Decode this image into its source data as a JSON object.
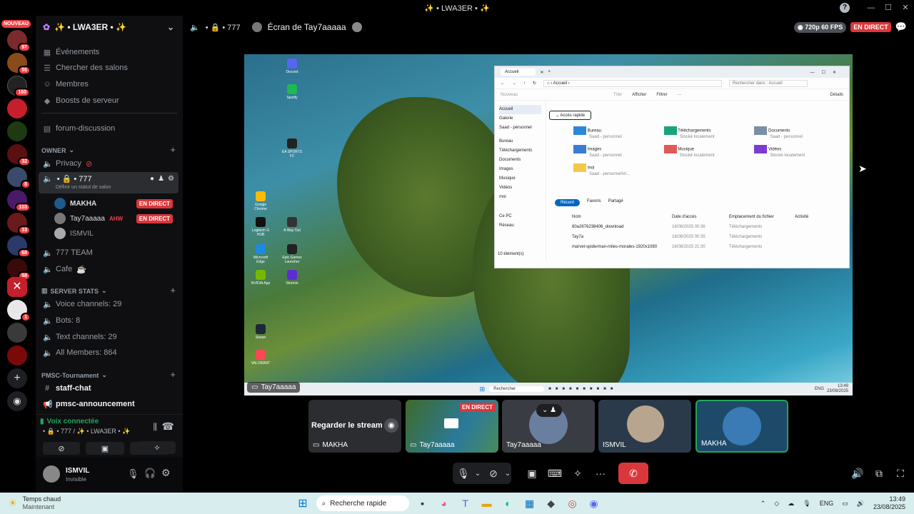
{
  "window": {
    "title": "✨ • LWA3ER • ✨"
  },
  "guilds": {
    "new_badge": "NOUVEAU",
    "badges": [
      "97",
      "56",
      "160",
      "32",
      "8",
      "103",
      "33",
      "68",
      "58",
      "1"
    ]
  },
  "server": {
    "name": "✨ • LWA3ER • ✨",
    "menu": [
      "Événements",
      "Chercher des salons",
      "Membres",
      "Boosts de serveur"
    ],
    "forum": "forum-discussion",
    "category_owner": "OWNER",
    "privacy": "Privacy",
    "voice_channel": "• 🔒 • 777",
    "voice_status": "Définir un statut de salon",
    "voice_users": [
      {
        "name": "MAKHA",
        "live": "EN DIRECT"
      },
      {
        "name": "Tay7aaaaa",
        "tag": "AHW",
        "live": "EN DIRECT"
      },
      {
        "name": "ISMVIL"
      }
    ],
    "team": "777 TEAM",
    "cafe": "Cafe",
    "category_stats": "SERVER STATS",
    "stats": [
      "Voice channels: 29",
      "Bots: 8",
      "Text channels: 29",
      "All Members: 864"
    ],
    "category_pmsc": "PMSC-Tournament",
    "pmsc_channels": [
      "staff-chat",
      "pmsc-announcement"
    ]
  },
  "voice": {
    "status": "Voix connectée",
    "location": "• 🔒 • 777 / ✨ • LWA3ER • ✨"
  },
  "user": {
    "name": "ISMVIL",
    "status": "Invisible"
  },
  "stage": {
    "channel": "• 🔒 • 777",
    "screen": "Écran de Tay7aaaaa",
    "quality": "720p 60 FPS",
    "live": "EN DIRECT",
    "streamer": "Tay7aaaaa"
  },
  "explorer": {
    "tab": "Accueil",
    "address": "Accueil",
    "search": "Rechercher dans : Accueil",
    "section_quick": "Accès rapide",
    "quick": [
      {
        "name": "Bureau",
        "sub": "Saad - personnel"
      },
      {
        "name": "Téléchargements",
        "sub": "Stocké localement"
      },
      {
        "name": "Documents",
        "sub": "Saad - personnel"
      },
      {
        "name": "Images",
        "sub": "Saad - personnel"
      },
      {
        "name": "Musique",
        "sub": "Stocké localement"
      },
      {
        "name": "Vidéos",
        "sub": "Stocké localement"
      },
      {
        "name": "moi",
        "sub": "Saad - personnel\\m..."
      }
    ],
    "tabs": [
      "Récent",
      "Favoris",
      "Partagé"
    ],
    "cols": [
      "Nom",
      "Date d'accès",
      "Emplacement du fichier",
      "Activité"
    ],
    "files": [
      {
        "name": "60a2676238406_download",
        "date": "18/08/2025 00:36",
        "loc": "Téléchargements"
      },
      {
        "name": "Tay7a",
        "date": "18/08/2025 00:35",
        "loc": "Téléchargements"
      },
      {
        "name": "marvel-spiderman-miles-morales-1920x1080",
        "date": "16/08/2025 21:30",
        "loc": "Téléchargements"
      }
    ],
    "nav": [
      "Accueil",
      "Galerie",
      "Saad - personnel",
      "Bureau",
      "Téléchargements",
      "Documents",
      "Images",
      "Musique",
      "Vidéos",
      "moi",
      "Ce PC",
      "Réseau"
    ],
    "count": "10 élément(s)",
    "toolbar": [
      "Nouveau",
      "Trier",
      "Afficher",
      "Filtrer",
      "Détails"
    ]
  },
  "desktop_icons": [
    "Google Chrome",
    "Logitech G HUB",
    "Microsoft Edge",
    "NVIDIA App",
    "Steam",
    "VALORANT",
    "Spotify",
    "Discord",
    "EA SPORTS FC",
    "A Way Out",
    "Epic Games Launcher",
    "Stremio"
  ],
  "inner_taskbar": {
    "search": "Rechercher",
    "time": "13:49",
    "date": "23/08/2025",
    "lang": "ENG"
  },
  "tiles": [
    {
      "label": "Regarder le stream",
      "name": "MAKHA"
    },
    {
      "name": "Tay7aaaaa",
      "live": "EN DIRECT"
    },
    {
      "name": "Tay7aaaaa"
    },
    {
      "name": "ISMVIL"
    },
    {
      "name": "MAKHA"
    }
  ],
  "taskbar": {
    "weather": "Temps chaud",
    "weather_sub": "Maintenant",
    "search": "Recherche rapide",
    "lang": "ENG",
    "time": "13:49",
    "date": "23/08/2025"
  },
  "colors": {
    "live": "#da373c",
    "blurple": "#5865f2",
    "green": "#23a55a"
  }
}
